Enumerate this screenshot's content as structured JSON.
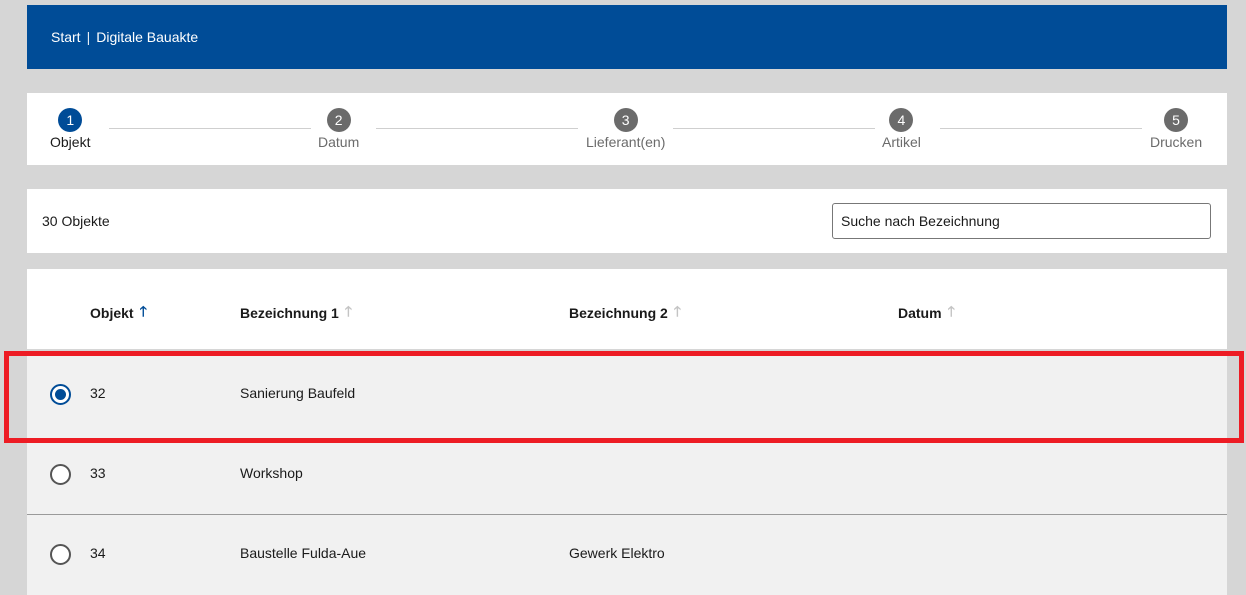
{
  "breadcrumb": {
    "start": "Start",
    "separator": "|",
    "current": "Digitale Bauakte"
  },
  "stepper": {
    "steps": [
      {
        "number": "1",
        "label": "Objekt",
        "active": true
      },
      {
        "number": "2",
        "label": "Datum",
        "active": false
      },
      {
        "number": "3",
        "label": "Lieferant(en)",
        "active": false
      },
      {
        "number": "4",
        "label": "Artikel",
        "active": false
      },
      {
        "number": "5",
        "label": "Drucken",
        "active": false
      }
    ]
  },
  "toolbar": {
    "count_label": "30 Objekte",
    "search_placeholder": "Suche nach Bezeichnung"
  },
  "table": {
    "columns": [
      {
        "label": "Objekt",
        "sort_icon": "arrow-up-icon",
        "sorted": true
      },
      {
        "label": "Bezeichnung 1",
        "sort_icon": "arrow-up-icon",
        "sorted": false
      },
      {
        "label": "Bezeichnung 2",
        "sort_icon": "arrow-up-icon",
        "sorted": false
      },
      {
        "label": "Datum",
        "sort_icon": "arrow-up-icon",
        "sorted": false
      }
    ],
    "rows": [
      {
        "objekt": "32",
        "bezeichnung1": "Sanierung Baufeld",
        "bezeichnung2": "",
        "datum": "",
        "selected": true
      },
      {
        "objekt": "33",
        "bezeichnung1": "Workshop",
        "bezeichnung2": "",
        "datum": "",
        "selected": false
      },
      {
        "objekt": "34",
        "bezeichnung1": "Baustelle Fulda-Aue",
        "bezeichnung2": "Gewerk Elektro",
        "datum": "",
        "selected": false
      }
    ]
  },
  "colors": {
    "brand": "#004c97",
    "highlight": "#ed1c24",
    "page_background": "#d6d6d6"
  }
}
